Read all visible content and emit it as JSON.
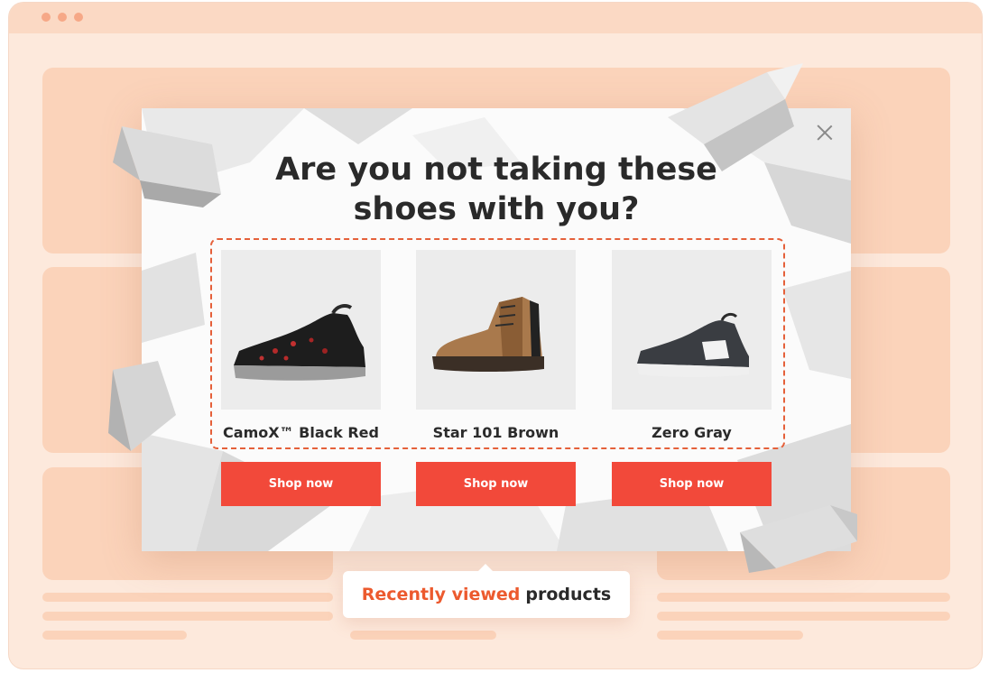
{
  "window": {
    "titlebar_dots": [
      "close-dot",
      "minimize-dot",
      "maximize-dot"
    ],
    "colors": {
      "background": "#fde9dc",
      "placeholder": "#fbd3ba",
      "accent": "#f2493a"
    }
  },
  "popup": {
    "close_icon": "close-icon",
    "headline_line1": "Are you not taking these",
    "headline_line2": "shoes with you?",
    "products": [
      {
        "name": "CamoX™ Black Red",
        "button": "Shop now",
        "image": "black-red-sneaker"
      },
      {
        "name": "Star 101 Brown",
        "button": "Shop now",
        "image": "brown-work-boot"
      },
      {
        "name": "Zero Gray",
        "button": "Shop now",
        "image": "gray-sneaker"
      }
    ]
  },
  "callout": {
    "highlight": "Recently viewed",
    "rest": "products"
  }
}
